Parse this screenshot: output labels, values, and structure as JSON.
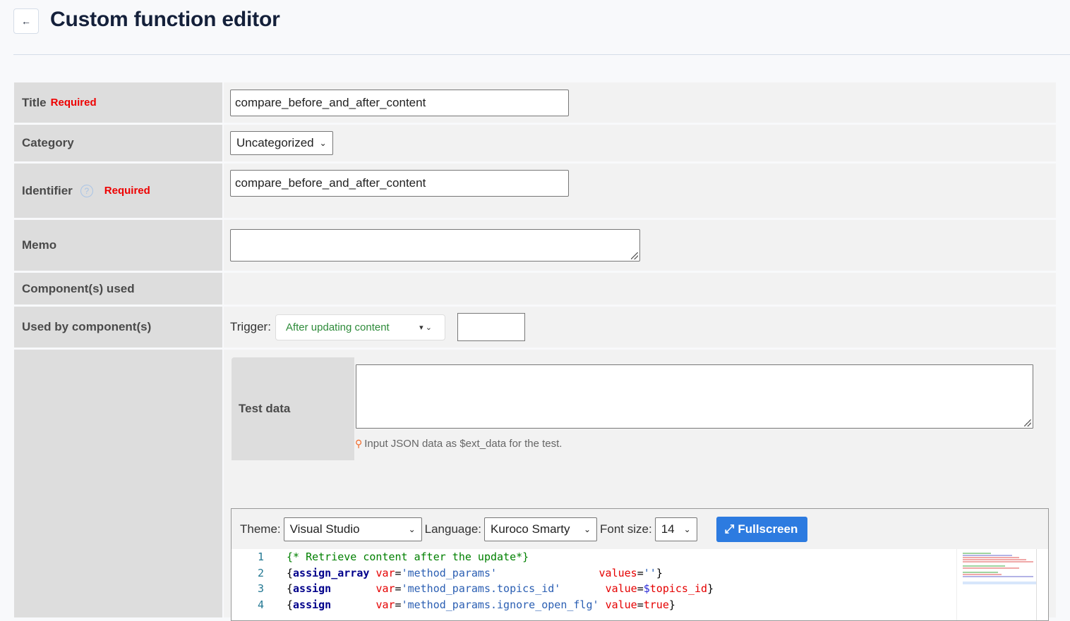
{
  "header": {
    "title": "Custom function editor",
    "back_icon": "arrow-left-icon",
    "back_glyph": "←"
  },
  "form": {
    "required_label": "Required",
    "title": {
      "label": "Title",
      "value": "compare_before_and_after_content"
    },
    "category": {
      "label": "Category",
      "selected": "Uncategorized"
    },
    "identifier": {
      "label": "Identifier",
      "help_glyph": "?",
      "value": "compare_before_and_after_content"
    },
    "memo": {
      "label": "Memo",
      "value": ""
    },
    "components_used": {
      "label": "Component(s) used"
    },
    "used_by": {
      "label": "Used by component(s)",
      "trigger_label": "Trigger:",
      "trigger_selected": "After updating content",
      "trigger_arrows": "▾ ⌄",
      "extra_value": ""
    },
    "test_data": {
      "label": "Test data",
      "value": "",
      "hint": "Input JSON data as $ext_data for the test.",
      "hint_icon_glyph": "💡"
    }
  },
  "editor": {
    "theme_label": "Theme:",
    "theme_selected": "Visual Studio",
    "language_label": "Language:",
    "language_selected": "Kuroco Smarty",
    "font_size_label": "Font size:",
    "font_size_selected": "14",
    "fullscreen_label": "Fullscreen",
    "fullscreen_glyph": "⤢",
    "lines": [
      {
        "n": "1",
        "tokens": [
          [
            "tk-comment",
            "{* Retrieve content after the update*}"
          ]
        ]
      },
      {
        "n": "2",
        "tokens": [
          [
            "tk-brace",
            "{"
          ],
          [
            "tk-kw",
            "assign_array"
          ],
          [
            "tk-brace",
            " "
          ],
          [
            "tk-attr",
            "var"
          ],
          [
            "tk-brace",
            "="
          ],
          [
            "tk-str",
            "'method_params'"
          ],
          [
            "tk-brace",
            "                "
          ],
          [
            "tk-attr",
            "values"
          ],
          [
            "tk-brace",
            "="
          ],
          [
            "tk-str",
            "''"
          ],
          [
            "tk-brace",
            "}"
          ]
        ]
      },
      {
        "n": "3",
        "tokens": [
          [
            "tk-brace",
            "{"
          ],
          [
            "tk-kw",
            "assign"
          ],
          [
            "tk-brace",
            "       "
          ],
          [
            "tk-attr",
            "var"
          ],
          [
            "tk-brace",
            "="
          ],
          [
            "tk-str",
            "'method_params.topics_id'"
          ],
          [
            "tk-brace",
            "       "
          ],
          [
            "tk-attr",
            "value"
          ],
          [
            "tk-brace",
            "="
          ],
          [
            "tk-var",
            "$"
          ],
          [
            "tk-attr",
            "topics_id"
          ],
          [
            "tk-brace",
            "}"
          ]
        ]
      },
      {
        "n": "4",
        "tokens": [
          [
            "tk-brace",
            "{"
          ],
          [
            "tk-kw",
            "assign"
          ],
          [
            "tk-brace",
            "       "
          ],
          [
            "tk-attr",
            "var"
          ],
          [
            "tk-brace",
            "="
          ],
          [
            "tk-str",
            "'method_params.ignore_open_flg'"
          ],
          [
            "tk-brace",
            " "
          ],
          [
            "tk-attr",
            "value"
          ],
          [
            "tk-brace",
            "="
          ],
          [
            "tk-attr",
            "true"
          ],
          [
            "tk-brace",
            "}"
          ]
        ]
      }
    ]
  }
}
